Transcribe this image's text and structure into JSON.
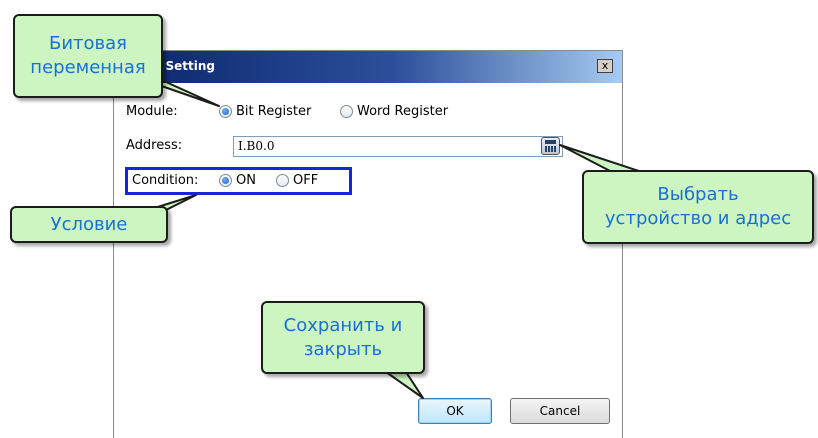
{
  "dialog": {
    "title": "dition Setting",
    "close_label": "x",
    "module_label": "Module:",
    "module_options": [
      {
        "label": "Bit Register",
        "checked": true
      },
      {
        "label": "Word Register",
        "checked": false
      }
    ],
    "address_label": "Address:",
    "address_value": "I.B0.0",
    "calc_icon": "calculator-icon",
    "condition_label": "Condition:",
    "condition_options": [
      {
        "label": "ON",
        "checked": true
      },
      {
        "label": "OFF",
        "checked": false
      }
    ],
    "ok_label": "OK",
    "cancel_label": "Cancel"
  },
  "callouts": {
    "bit_variable": {
      "line1": "Битовая",
      "line2": "переменная"
    },
    "condition": "Условие",
    "select_device": {
      "line1": "Выбрать",
      "line2": "устройство и адрес"
    },
    "save_close": {
      "line1": "Сохранить и",
      "line2": "закрыть"
    }
  },
  "colors": {
    "callout_bg": "#ccf5c1",
    "callout_text": "#1a6fd4",
    "highlight_box": "#1a24d8",
    "titlebar": "#0a246a"
  }
}
